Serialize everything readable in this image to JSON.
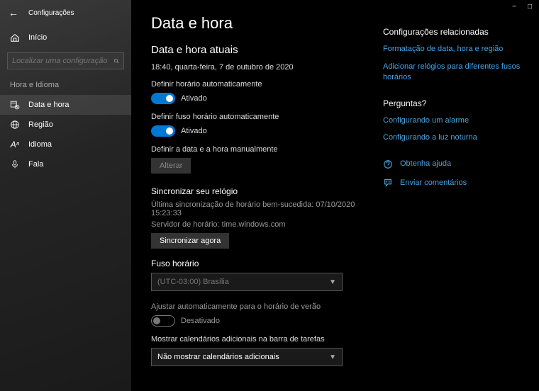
{
  "window": {
    "title": "Configurações"
  },
  "sidebar": {
    "home": "Início",
    "search_placeholder": "Localizar uma configuração",
    "section": "Hora e Idioma",
    "items": [
      {
        "label": "Data e hora"
      },
      {
        "label": "Região"
      },
      {
        "label": "Idioma"
      },
      {
        "label": "Fala"
      }
    ]
  },
  "page": {
    "title": "Data e hora",
    "current_heading": "Data e hora atuais",
    "current_value": "18:40, quarta-feira, 7 de outubro de 2020",
    "auto_time_label": "Definir horário automaticamente",
    "auto_time_state": "Ativado",
    "auto_tz_label": "Definir fuso horário automaticamente",
    "auto_tz_state": "Ativado",
    "manual_label": "Definir a data e a hora manualmente",
    "change_btn": "Alterar",
    "sync_heading": "Sincronizar seu relógio",
    "sync_last": "Última sincronização de horário bem-sucedida: 07/10/2020 15:23:33",
    "sync_server": "Servidor de horário: time.windows.com",
    "sync_btn": "Sincronizar agora",
    "tz_heading": "Fuso horário",
    "tz_value": "(UTC-03:00) Brasília",
    "dst_label": "Ajustar automaticamente para o horário de verão",
    "dst_state": "Desativado",
    "extra_cal_label": "Mostrar calendários adicionais na barra de tarefas",
    "extra_cal_value": "Não mostrar calendários adicionais"
  },
  "rail": {
    "related_heading": "Configurações relacionadas",
    "link_format": "Formatação de data, hora e região",
    "link_clocks": "Adicionar relógios para diferentes fusos horários",
    "questions_heading": "Perguntas?",
    "link_alarm": "Configurando um alarme",
    "link_night": "Configurando a luz noturna",
    "help": "Obtenha ajuda",
    "feedback": "Enviar comentários"
  }
}
